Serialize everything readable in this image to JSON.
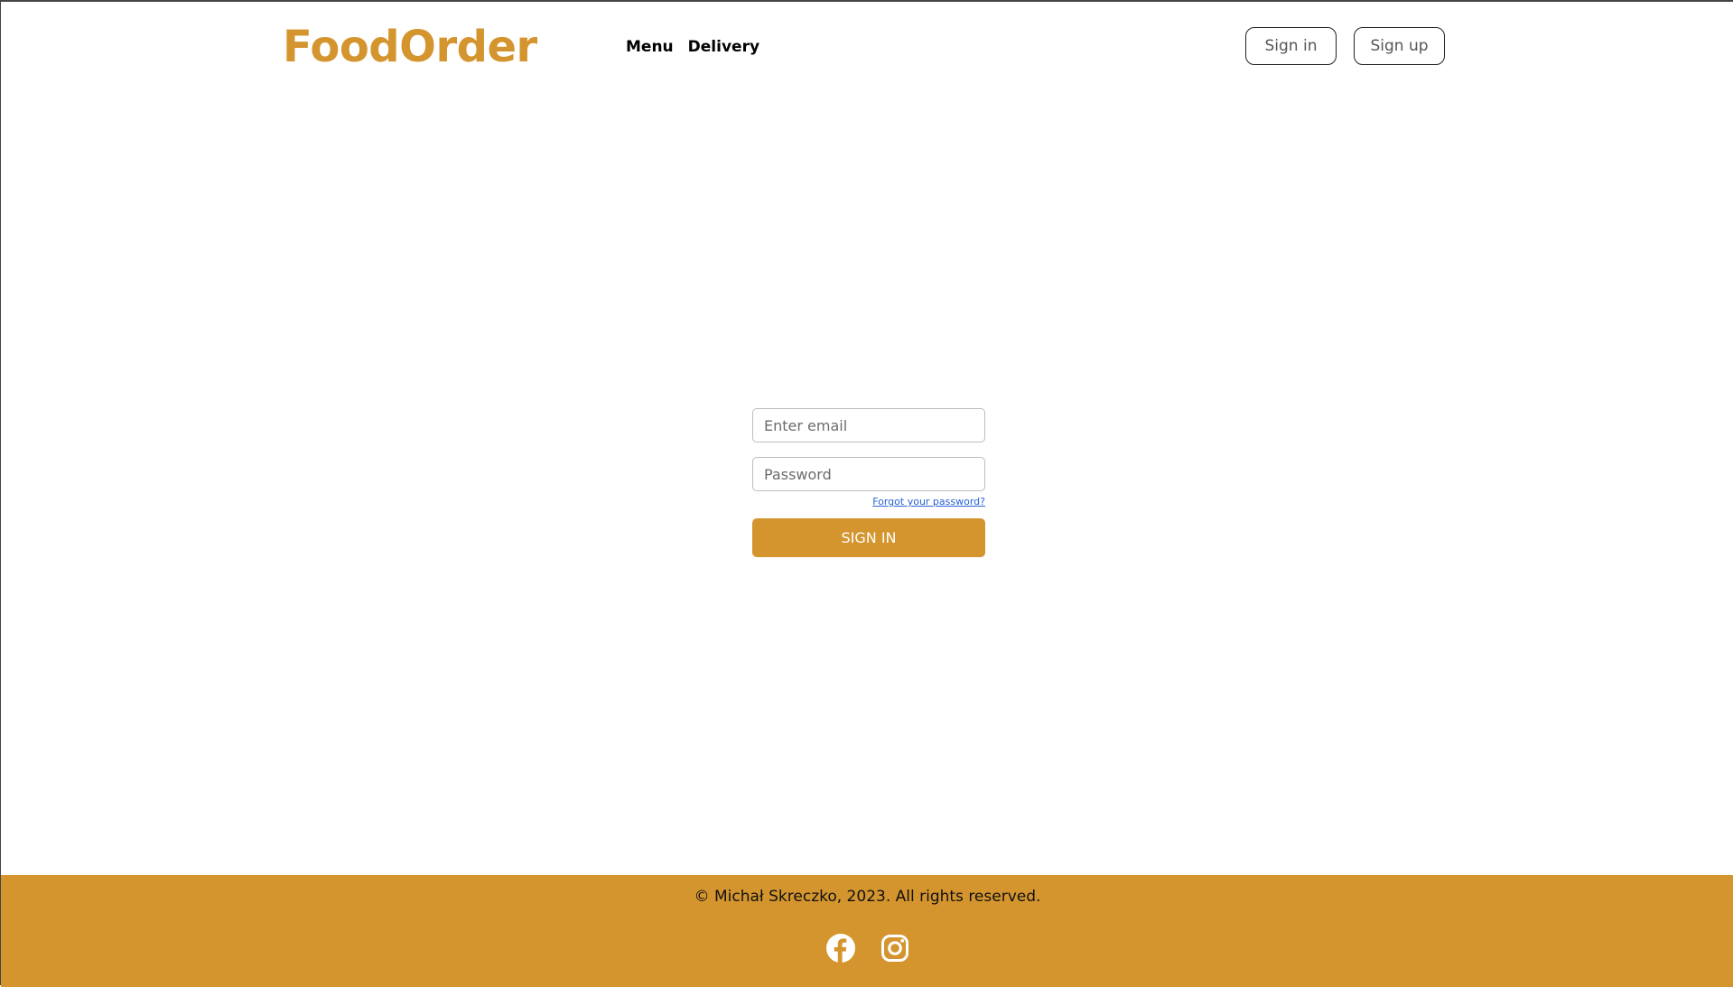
{
  "colors": {
    "brand": "#d4952f",
    "footer_bg": "#d4952f",
    "link": "#2a62d6"
  },
  "header": {
    "logo": "FoodOrder",
    "nav": [
      "Menu",
      "Delivery"
    ],
    "sign_in_label": "Sign in",
    "sign_up_label": "Sign up"
  },
  "login_form": {
    "email_placeholder": "Enter email",
    "password_placeholder": "Password",
    "forgot_label": "Forgot your password?",
    "submit_label": "SIGN IN"
  },
  "footer": {
    "copyright": "© Michał Skreczko, 2023. All rights reserved.",
    "social_icons": [
      "facebook-icon",
      "instagram-icon"
    ]
  }
}
